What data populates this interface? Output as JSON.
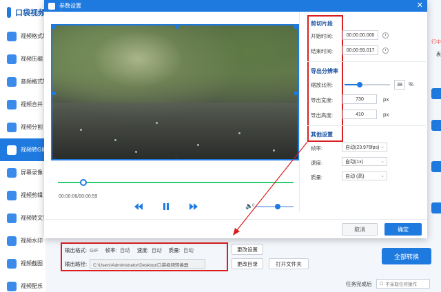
{
  "app": {
    "title": "口袋视频",
    "sidebar": [
      {
        "label": "视频格式转"
      },
      {
        "label": "视频压缩"
      },
      {
        "label": "音频格式转"
      },
      {
        "label": "视频合并"
      },
      {
        "label": "视频分割"
      },
      {
        "label": "视频转GIF"
      },
      {
        "label": "屏幕录像"
      },
      {
        "label": "视频剪辑"
      },
      {
        "label": "视频转文字"
      },
      {
        "label": "视频水印"
      },
      {
        "label": "视频截图"
      },
      {
        "label": "视频配乐"
      }
    ],
    "right_hints": [
      "行中",
      "表"
    ]
  },
  "dialog": {
    "title": "参数设置",
    "close": "✕",
    "player": {
      "time": "00:00:06/00:00:59",
      "volume_value": "0"
    },
    "clip": {
      "section_title": "剪切片段",
      "start_label": "开始时间:",
      "start_value": "00:00:00.000",
      "end_label": "结束时间:",
      "end_value": "00:00:59.017"
    },
    "resolution": {
      "section_title": "导出分辨率",
      "scale_label": "缩放比例:",
      "scale_value": "38",
      "scale_unit": "%",
      "width_label": "导出宽度:",
      "width_value": "730",
      "width_unit": "px",
      "height_label": "导出高度:",
      "height_value": "410",
      "height_unit": "px"
    },
    "other": {
      "section_title": "其他设置",
      "fps_label": "帧率:",
      "fps_value": "自动(23.976fps)",
      "speed_label": "速度:",
      "speed_value": "自动(1x)",
      "quality_label": "质量:",
      "quality_value": "自动 (高)"
    },
    "cancel_label": "取消",
    "ok_label": "确定"
  },
  "output": {
    "format_label": "输出格式:",
    "format_value": "GIF",
    "fps_label": "帧率:",
    "fps_value": "自动",
    "speed_label": "速度:",
    "speed_value": "自动",
    "quality_label": "质量:",
    "quality_value": "自动",
    "change_settings": "更改设置",
    "path_label": "输出路径:",
    "path_value": "C:\\Users\\Administrator\\Desktop\\口袋视频转换器",
    "change_dir": "更改目录",
    "open_folder": "打开文件夹",
    "convert_all": "全部转换",
    "after_label": "任务完成后",
    "after_value": "不采取任何操作"
  },
  "colors": {
    "accent": "#1f7ae0",
    "highlight": "#d81e1e",
    "timeline": "#2ecc71"
  }
}
